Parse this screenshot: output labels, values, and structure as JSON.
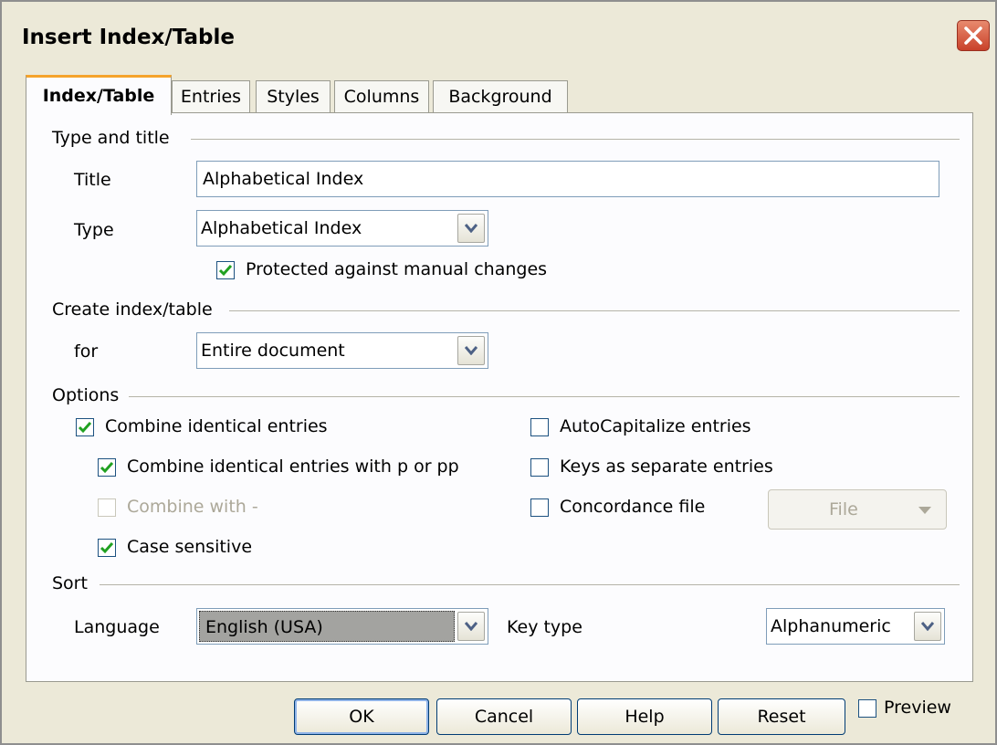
{
  "window": {
    "title": "Insert Index/Table",
    "close_icon": "close-icon"
  },
  "tabs": [
    {
      "label": "Index/Table",
      "active": true
    },
    {
      "label": "Entries",
      "active": false
    },
    {
      "label": "Styles",
      "active": false
    },
    {
      "label": "Columns",
      "active": false
    },
    {
      "label": "Background",
      "active": false
    }
  ],
  "type_and_title": {
    "section_label": "Type and title",
    "title_label": "Title",
    "title_value": "Alphabetical Index",
    "type_label": "Type",
    "type_value": "Alphabetical Index",
    "protected_label": "Protected against manual changes",
    "protected_checked": true
  },
  "create_index": {
    "section_label": "Create index/table",
    "for_label": "for",
    "for_value": "Entire document"
  },
  "options": {
    "section_label": "Options",
    "combine_identical": {
      "label": "Combine identical entries",
      "checked": true
    },
    "combine_p_pp": {
      "label": "Combine identical entries with p or pp",
      "checked": true
    },
    "combine_with_dash": {
      "label": "Combine with -",
      "checked": false,
      "disabled": true
    },
    "case_sensitive": {
      "label": "Case sensitive",
      "checked": true
    },
    "autocapitalize": {
      "label": "AutoCapitalize entries",
      "checked": false
    },
    "keys_separate": {
      "label": "Keys as separate entries",
      "checked": false
    },
    "concordance": {
      "label": "Concordance file",
      "checked": false
    },
    "file_button": "File"
  },
  "sort": {
    "section_label": "Sort",
    "language_label": "Language",
    "language_value": "English (USA)",
    "key_type_label": "Key type",
    "key_type_value": "Alphanumeric"
  },
  "buttons": {
    "ok": "OK",
    "cancel": "Cancel",
    "help": "Help",
    "reset": "Reset"
  },
  "preview": {
    "label": "Preview",
    "checked": false
  },
  "colors": {
    "tab_accent": "#f5a32b",
    "check": "#21a121",
    "close_button": "#c9412a",
    "dialog_bg": "#ece9d8"
  }
}
